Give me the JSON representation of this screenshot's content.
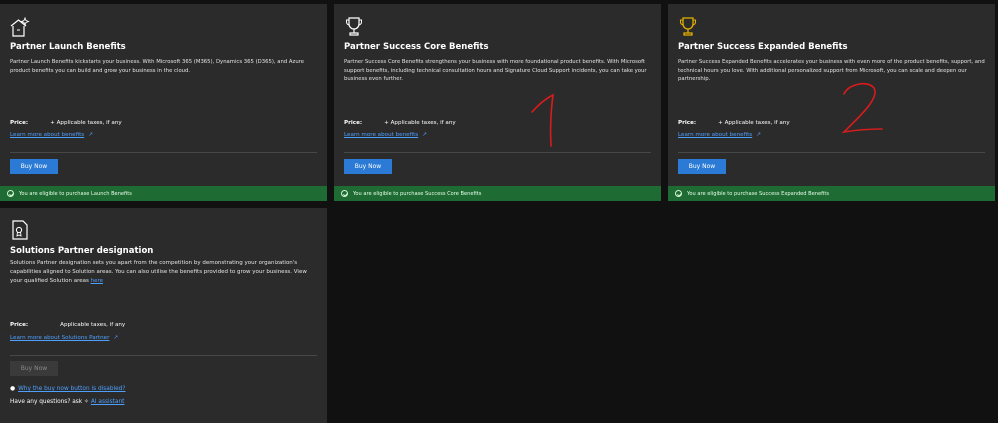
{
  "cards": [
    {
      "title": "Partner Launch Benefits",
      "description": "Partner Launch Benefits kickstarts your business. With Microsoft 365 (M365), Dynamics 365 (D365), and Azure product benefits you can build and grow your business in the cloud.",
      "price_label": "Price:",
      "price_value": "+ Applicable taxes, if any",
      "learn_more": "Learn more about benefits",
      "buy_label": "Buy Now",
      "eligible_text": "You are eligible to purchase Launch Benefits",
      "icon": "rocket-sparkle-icon"
    },
    {
      "title": "Partner Success Core Benefits",
      "description": "Partner Success Core Benefits strengthens your business with more foundational product benefits. With Microsoft support benefits, including technical consultation hours and Signature Cloud Support incidents, you can take your business even further.",
      "price_label": "Price:",
      "price_value": "+ Applicable taxes, if any",
      "learn_more": "Learn more about benefits",
      "buy_label": "Buy Now",
      "eligible_text": "You are eligible to purchase Success Core Benefits",
      "icon": "trophy-outline-icon",
      "annotation": "1"
    },
    {
      "title": "Partner Success Expanded Benefits",
      "description": "Partner Success Expanded Benefits accelerates your business with even more of the product benefits, support, and technical hours you love. With additional personalized support from Microsoft, you can scale and deepen our partnership.",
      "price_label": "Price:",
      "price_value": "+ Applicable taxes, if any",
      "learn_more": "Learn more about benefits",
      "buy_label": "Buy Now",
      "eligible_text": "You are eligible to purchase Success Expanded Benefits",
      "icon": "trophy-gold-icon",
      "annotation": "2"
    }
  ],
  "solutions": {
    "title": "Solutions Partner designation",
    "description": "Solutions Partner designation sets you apart from the competition by demonstrating your organization's capabilities aligned to Solution areas. You can also utilise the benefits provided to grow your business. View your qualified Solution areas",
    "here_link": "here",
    "price_label": "Price:",
    "price_value": "Applicable taxes, if any",
    "learn_more": "Learn more about Solutions Partner",
    "buy_label": "Buy Now",
    "why_link": "Why the buy now button is disabled?",
    "ask_text": "Have any questions? ask",
    "ai_link": "AI assistant",
    "icon": "certificate-icon"
  },
  "colors": {
    "accent_blue": "#2a7ad6",
    "link_blue": "#4ea0ff",
    "eligible_green": "#1f6b34",
    "annotation_red": "#d81c1c",
    "trophy_gold": "#e2b100"
  }
}
